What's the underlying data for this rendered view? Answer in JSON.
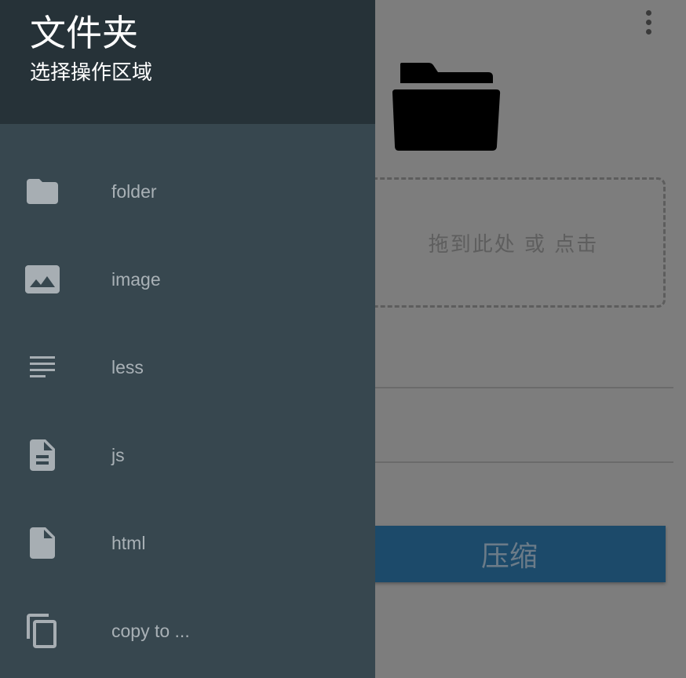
{
  "drawer": {
    "title": "文件夹",
    "subtitle": "选择操作区域",
    "items": [
      {
        "label": "folder",
        "icon": "folder-icon"
      },
      {
        "label": "image",
        "icon": "image-icon"
      },
      {
        "label": "less",
        "icon": "text-lines-icon"
      },
      {
        "label": "js",
        "icon": "document-icon"
      },
      {
        "label": "html",
        "icon": "file-icon"
      },
      {
        "label": "copy to ...",
        "icon": "copy-icon"
      }
    ]
  },
  "main": {
    "drop_zone_text": "拖到此处 或 点击",
    "compress_label": "压缩"
  },
  "colors": {
    "drawer_bg": "#37474f",
    "drawer_header_bg": "#263238",
    "overlay": "#7d7d7d",
    "button_bg": "#1c4a6a"
  }
}
